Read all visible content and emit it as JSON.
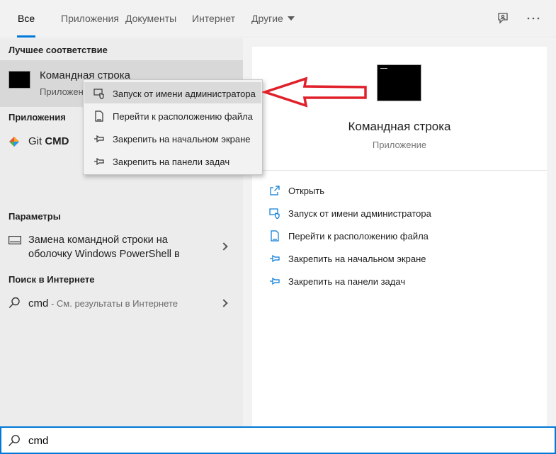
{
  "tabs": [
    {
      "label": "Все"
    },
    {
      "label": "Приложения"
    },
    {
      "label": "Документы"
    },
    {
      "label": "Интернет"
    },
    {
      "label": "Другие"
    }
  ],
  "left": {
    "best_match_title": "Лучшее соответствие",
    "best_match": {
      "title": "Командная строка",
      "subtitle": "Приложение"
    },
    "apps_title": "Приложения",
    "apps": [
      {
        "name_plain": "Git ",
        "name_bold": "CMD"
      }
    ],
    "settings_title": "Параметры",
    "settings": [
      {
        "line1": "Замена командной строки на",
        "line2": "оболочку Windows PowerShell в"
      }
    ],
    "web_title": "Поиск в Интернете",
    "web": [
      {
        "query": "cmd",
        "hint": " - См. результаты в Интернете"
      }
    ]
  },
  "context_menu": [
    {
      "label": "Запуск от имени администратора",
      "icon": "shield-icon"
    },
    {
      "label": "Перейти к расположению файла",
      "icon": "file-location-icon"
    },
    {
      "label": "Закрепить на начальном экране",
      "icon": "pin-icon"
    },
    {
      "label": "Закрепить на панели задач",
      "icon": "pin-icon"
    }
  ],
  "right": {
    "title": "Командная строка",
    "subtitle": "Приложение",
    "actions": [
      {
        "label": "Открыть",
        "icon": "open-icon"
      },
      {
        "label": "Запуск от имени администратора",
        "icon": "shield-icon"
      },
      {
        "label": "Перейти к расположению файла",
        "icon": "file-location-icon"
      },
      {
        "label": "Закрепить на начальном экране",
        "icon": "pin-icon"
      },
      {
        "label": "Закрепить на панели задач",
        "icon": "pin-icon"
      }
    ]
  },
  "search": {
    "value": "cmd"
  },
  "colors": {
    "accent": "#0078d7",
    "arrow": "#e0202a"
  }
}
